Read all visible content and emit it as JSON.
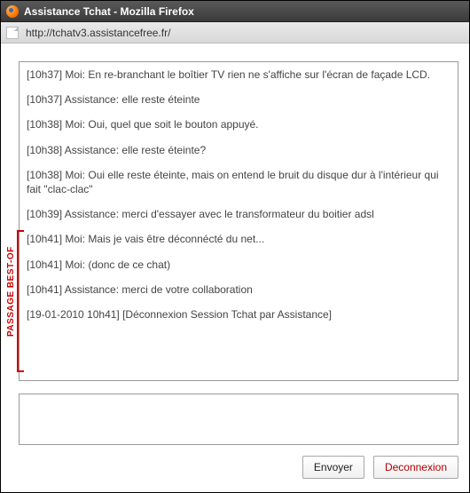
{
  "window": {
    "title": "Assistance Tchat - Mozilla Firefox",
    "url": "http://tchatv3.assistancefree.fr/"
  },
  "annotation": {
    "passage_label": "PASSAGE BEST-OF"
  },
  "chat": {
    "messages": [
      {
        "time": "10h37",
        "speaker": "Moi",
        "text": "En re-branchant le boîtier TV rien ne s'affiche sur l'écran de façade LCD."
      },
      {
        "time": "10h37",
        "speaker": "Assistance",
        "text": "elle reste éteinte"
      },
      {
        "time": "10h38",
        "speaker": "Moi",
        "text": "Oui, quel que soit le bouton appuyé."
      },
      {
        "time": "10h38",
        "speaker": "Assistance",
        "text": "elle reste éteinte?"
      },
      {
        "time": "10h38",
        "speaker": "Moi",
        "text": "Oui elle reste éteinte, mais on entend le bruit du disque dur à l'intérieur qui fait \"clac-clac\""
      },
      {
        "time": "10h39",
        "speaker": "Assistance",
        "text": "merci d'essayer avec le transformateur du boitier adsl"
      },
      {
        "time": "10h41",
        "speaker": "Moi",
        "text": "Mais je vais être déconnécté du net..."
      },
      {
        "time": "10h41",
        "speaker": "Moi",
        "text": "(donc de ce chat)"
      },
      {
        "time": "10h41",
        "speaker": "Assistance",
        "text": "merci de votre collaboration"
      }
    ],
    "system_message": "[19-01-2010 10h41] [Déconnexion Session Tchat par Assistance]",
    "input_value": ""
  },
  "buttons": {
    "send": "Envoyer",
    "disconnect": "Deconnexion"
  }
}
